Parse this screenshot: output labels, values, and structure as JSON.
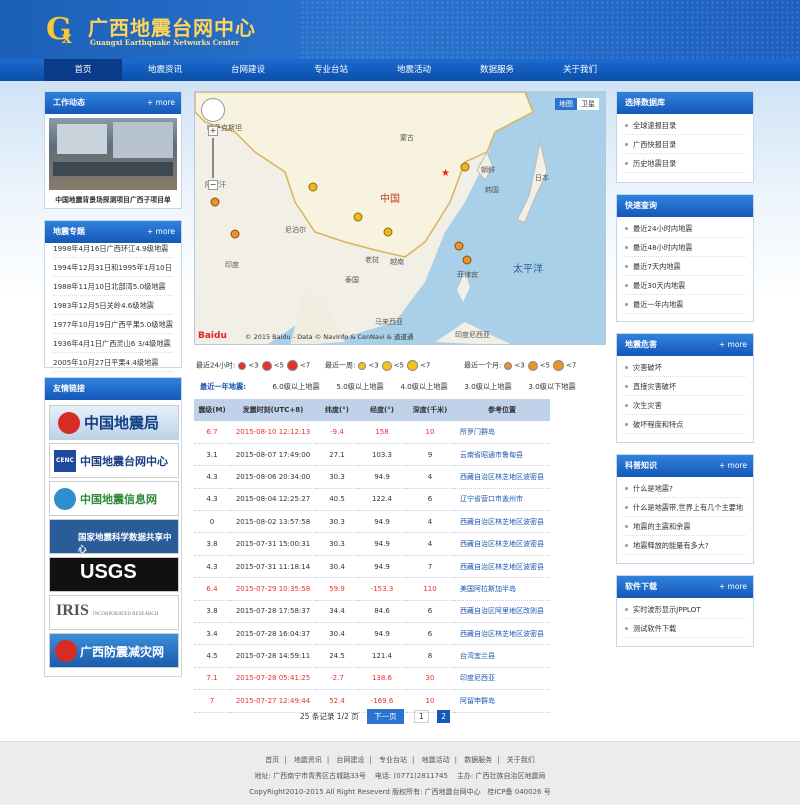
{
  "header": {
    "title": "广西地震台网中心",
    "subtitle": "Guangxi Earthquake Networks Center"
  },
  "nav": [
    "首页",
    "地震资讯",
    "台网建设",
    "专业台站",
    "地震活动",
    "数据服务",
    "关于我们"
  ],
  "left": {
    "work": {
      "title": "工作动态",
      "more": "+ more",
      "caption": "中国地震背景场探测项目广西子项目单"
    },
    "topics": {
      "title": "地震专题",
      "more": "+ more",
      "items": [
        "1998年4月16日广西环江4.9级地震",
        "1994年12月31日和1995年1月10日",
        "1988年11月10日北部湾5.0级地震",
        "1983年12月5日关岭4.6级地震",
        "1977年10月19日广西平果5.0级地震",
        "1936年4月1日广西灵山6 3/4级地震",
        "2005年10月27日平果4.4级地震"
      ]
    },
    "links": {
      "title": "友情链接",
      "logos": [
        "中国地震局",
        "中国地震台网中心",
        "中国地震信息网",
        "国家地震科学数据共享中心",
        "USGS",
        "IRIS",
        "广西防震减灾网"
      ]
    }
  },
  "map": {
    "type_map": "地图",
    "type_sat": "卫星",
    "labels": {
      "china": "中国",
      "pacific": "太平洋",
      "mongolia": "蒙古",
      "japan": "日本",
      "korea": "韩国",
      "dprk": "朝鲜",
      "kazakh": "哈萨克斯坦",
      "nepal": "尼泊尔",
      "india": "印度",
      "laos": "老挝",
      "thailand": "泰国",
      "vietnam": "越南",
      "philippines": "菲律宾",
      "malaysia": "马来西亚",
      "indonesia": "印度尼西亚",
      "afghan": "阿富汗"
    },
    "copyright": "© 2015 Baidu - Data © NavInfo & CenNavi & 道道通"
  },
  "legend": {
    "day": "最近24小时:",
    "week": "最近一周:",
    "month": "最近一个月:",
    "l3": "<3",
    "l5": "<5",
    "l7": "<7"
  },
  "tabs": [
    "最近一年地震:",
    "6.0级以上地震",
    "5.0级以上地震",
    "4.0级以上地震",
    "3.0级以上地震",
    "3.0级以下地震"
  ],
  "table": {
    "headers": [
      "震级(M)",
      "发震时刻(UTC+8)",
      "纬度(°)",
      "经度(°)",
      "深度(千米)",
      "参考位置"
    ],
    "rows": [
      [
        "6.7",
        "2015-08-10 12:12:13",
        "-9.4",
        "158",
        "10",
        "所罗门群岛"
      ],
      [
        "3.1",
        "2015-08-07 17:49:00",
        "27.1",
        "103.3",
        "9",
        "云南省昭通市鲁甸县"
      ],
      [
        "4.3",
        "2015-08-06 20:34:00",
        "30.3",
        "94.9",
        "4",
        "西藏自治区林芝地区波密县"
      ],
      [
        "4.3",
        "2015-08-04 12:25:27",
        "40.5",
        "122.4",
        "6",
        "辽宁省营口市盖州市"
      ],
      [
        "0",
        "2015-08-02 13:57:58",
        "30.3",
        "94.9",
        "4",
        "西藏自治区林芝地区波密县"
      ],
      [
        "3.8",
        "2015-07-31 15:00:31",
        "30.3",
        "94.9",
        "4",
        "西藏自治区林芝地区波密县"
      ],
      [
        "4.3",
        "2015-07-31 11:18:14",
        "30.4",
        "94.9",
        "7",
        "西藏自治区林芝地区波密县"
      ],
      [
        "6.4",
        "2015-07-29 10:35:58",
        "59.9",
        "-153.3",
        "110",
        "美国阿拉斯加半岛"
      ],
      [
        "3.8",
        "2015-07-28 17:58:37",
        "34.4",
        "84.6",
        "6",
        "西藏自治区阿里地区改则县"
      ],
      [
        "3.4",
        "2015-07-28 16:04:37",
        "30.4",
        "94.9",
        "6",
        "西藏自治区林芝地区波密县"
      ],
      [
        "4.5",
        "2015-07-28 14:59:11",
        "24.5",
        "121.4",
        "8",
        "台湾宜兰县"
      ],
      [
        "7.1",
        "2015-07-28 05:41:25",
        "-2.7",
        "138.6",
        "30",
        "印度尼西亚"
      ],
      [
        "7",
        "2015-07-27 12:49:44",
        "52.4",
        "-169.6",
        "10",
        "阿留申群岛"
      ]
    ]
  },
  "pager": {
    "summary": "25 条记录 1/2 页",
    "next": "下一页",
    "p1": "1",
    "p2": "2"
  },
  "right": {
    "db": {
      "title": "选择数据库",
      "items": [
        "全球速报目录",
        "广西快报目录",
        "历史地震目录"
      ]
    },
    "quick": {
      "title": "快速查询",
      "items": [
        "最近24小时内地震",
        "最近48小时内地震",
        "最近7天内地震",
        "最近30天内地震",
        "最近一年内地震"
      ]
    },
    "damage": {
      "title": "地震危害",
      "more": "+ more",
      "items": [
        "灾害破坏",
        "直接灾害破坏",
        "次生灾害",
        "破坏程度和特点"
      ]
    },
    "science": {
      "title": "科普知识",
      "more": "+ more",
      "items": [
        "什么是地震?",
        "什么是地震带,世界上有几个主要地",
        "地震的主震和余震",
        "地震释放的能量有多大?"
      ]
    },
    "soft": {
      "title": "软件下载",
      "more": "+ more",
      "items": [
        "实时波形显示JPPLOT",
        "测试软件下载"
      ]
    }
  },
  "footer": {
    "links": [
      "首页",
      "地震资讯",
      "台网建设",
      "专业台站",
      "地震活动",
      "数据服务",
      "关于我们"
    ],
    "address": "地址: 广西南宁市青秀区古城路33号",
    "phone": "电话: (0771)2811745",
    "host": "主办:",
    "host_name": "广西壮族自治区地震局",
    "copyright": "CopyRight2010-2015 All Right Reseverd 版权所有: 广西地震台网中心",
    "icp": "桂ICP备 040026 号"
  },
  "colors": {
    "header": "#1c5fb8",
    "nav": "#0b4fa8",
    "big_quake": "#e8312c",
    "link": "#1a56b0"
  }
}
